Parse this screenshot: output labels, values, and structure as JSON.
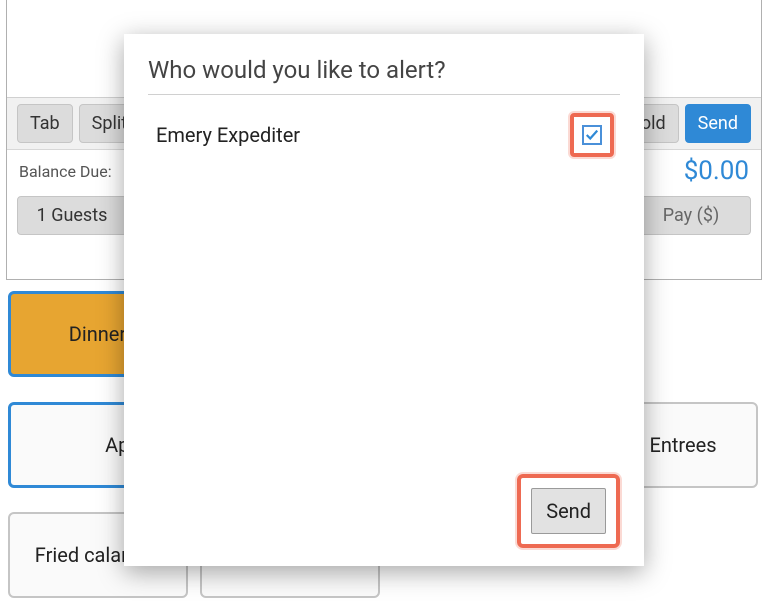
{
  "toolbar": {
    "tab": "Tab",
    "split": "Split",
    "hold": "Hold",
    "send": "Send"
  },
  "balance": {
    "label": "Balance Due:",
    "amount": "$0.00"
  },
  "guests": {
    "label": "1 Guests",
    "pay": "Pay ($)"
  },
  "menu": {
    "dinner": "Dinner Menu"
  },
  "categories": {
    "apps": "Apps",
    "entrees": "Entrees"
  },
  "items": {
    "calamari": "Fried calamari"
  },
  "modal": {
    "title": "Who would you like to alert?",
    "recipient": "Emery Expediter",
    "checked": true,
    "send": "Send"
  }
}
